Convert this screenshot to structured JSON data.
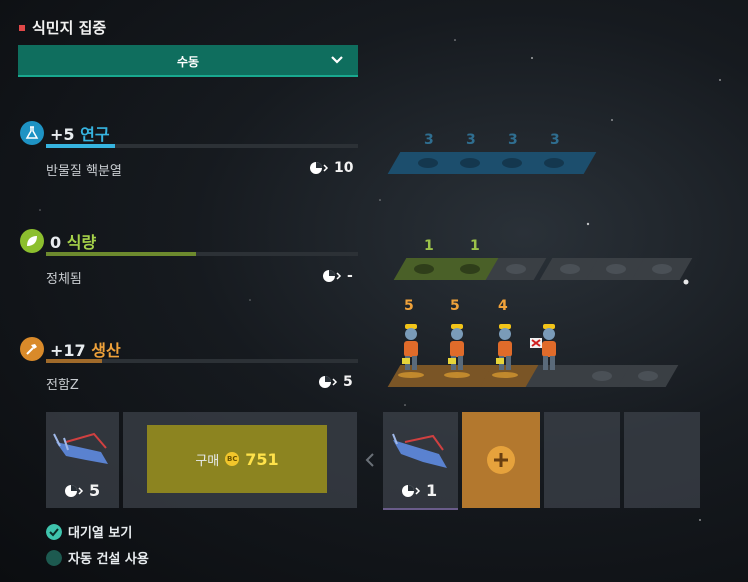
{
  "header": {
    "title": "식민지 집중",
    "dropdown_value": "수동"
  },
  "resources": [
    {
      "id": "research",
      "amount": "+5",
      "name": "연구",
      "name_color": "#36b4e0",
      "subtitle": "반물질 핵분열",
      "value": "10",
      "bar_fraction": 0.22
    },
    {
      "id": "food",
      "amount": "0",
      "name": "식량",
      "name_color": "#a6d24a",
      "subtitle": "정체됨",
      "value": "-",
      "bar_fraction": 0.48
    },
    {
      "id": "production",
      "amount": "+17",
      "name": "생산",
      "name_color": "#f0a23a",
      "subtitle": "전함Z",
      "value": "5",
      "bar_fraction": 0.18
    }
  ],
  "research_tiles": {
    "labels": [
      "3",
      "3",
      "3",
      "3"
    ]
  },
  "food_tiles": {
    "labels": [
      "1",
      "1"
    ]
  },
  "production_tiles": {
    "labels": [
      "5",
      "5",
      "4"
    ]
  },
  "queue": {
    "current_item_turns": "5",
    "buy_label": "구매",
    "buy_currency_icon": "BC",
    "buy_cost": "751",
    "queued_item_turns": "1"
  },
  "options": {
    "show_queue": "대기열 보기",
    "auto_build": "자동 건설 사용"
  },
  "colors": {
    "accent": "#19a88f",
    "research": "#36b4e0",
    "food": "#a6d24a",
    "production": "#f0a23a",
    "tile_orange": "#b3782e"
  }
}
